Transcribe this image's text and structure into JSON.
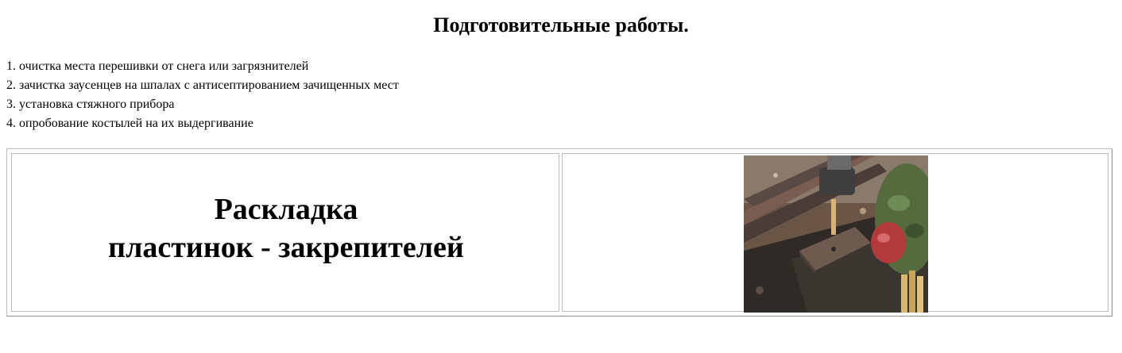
{
  "title": "Подготовительные работы.",
  "steps": [
    "1. очистка места перешивки от снега или загрязнителей",
    "2. зачистка заусенцев на шпалах с антисептированием зачищенных мест",
    "3. установка стяжного прибора",
    "4. опробование костылей на их выдергивание"
  ],
  "panel": {
    "caption_line1": "Раскладка",
    "caption_line2": "пластинок - закрепителей",
    "photo_subject": "photo of hammering spikes into rail tie plate"
  }
}
